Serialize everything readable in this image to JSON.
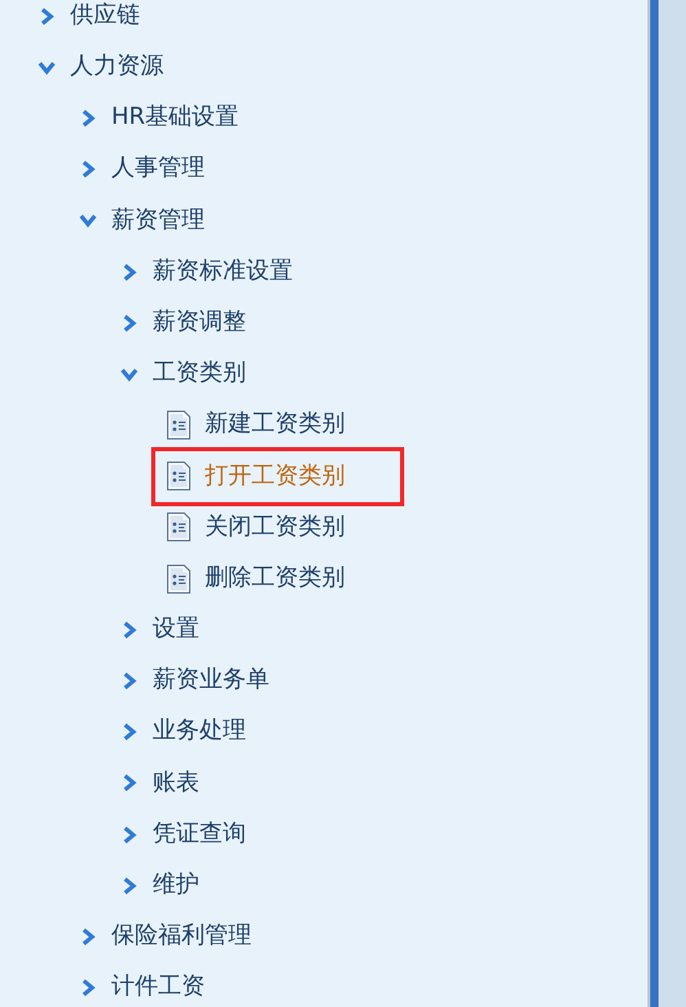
{
  "tree": [
    {
      "label": "供应链",
      "kind": "folder",
      "expanded": false,
      "selected": false
    },
    {
      "label": "人力资源",
      "kind": "folder",
      "expanded": true,
      "selected": false,
      "children": [
        {
          "label": "HR基础设置",
          "kind": "folder",
          "expanded": false,
          "selected": false
        },
        {
          "label": "人事管理",
          "kind": "folder",
          "expanded": false,
          "selected": false
        },
        {
          "label": "薪资管理",
          "kind": "folder",
          "expanded": true,
          "selected": false,
          "children": [
            {
              "label": "薪资标准设置",
              "kind": "folder",
              "expanded": false,
              "selected": false
            },
            {
              "label": "薪资调整",
              "kind": "folder",
              "expanded": false,
              "selected": false
            },
            {
              "label": "工资类别",
              "kind": "folder",
              "expanded": true,
              "selected": false,
              "children": [
                {
                  "label": "新建工资类别",
                  "kind": "leaf",
                  "selected": false
                },
                {
                  "label": "打开工资类别",
                  "kind": "leaf",
                  "selected": true
                },
                {
                  "label": "关闭工资类别",
                  "kind": "leaf",
                  "selected": false
                },
                {
                  "label": "删除工资类别",
                  "kind": "leaf",
                  "selected": false
                }
              ]
            },
            {
              "label": "设置",
              "kind": "folder",
              "expanded": false,
              "selected": false
            },
            {
              "label": "薪资业务单",
              "kind": "folder",
              "expanded": false,
              "selected": false
            },
            {
              "label": "业务处理",
              "kind": "folder",
              "expanded": false,
              "selected": false
            },
            {
              "label": "账表",
              "kind": "folder",
              "expanded": false,
              "selected": false
            },
            {
              "label": "凭证查询",
              "kind": "folder",
              "expanded": false,
              "selected": false
            },
            {
              "label": "维护",
              "kind": "folder",
              "expanded": false,
              "selected": false
            }
          ]
        },
        {
          "label": "保险福利管理",
          "kind": "folder",
          "expanded": false,
          "selected": false
        },
        {
          "label": "计件工资",
          "kind": "folder",
          "expanded": false,
          "selected": false
        }
      ]
    }
  ]
}
